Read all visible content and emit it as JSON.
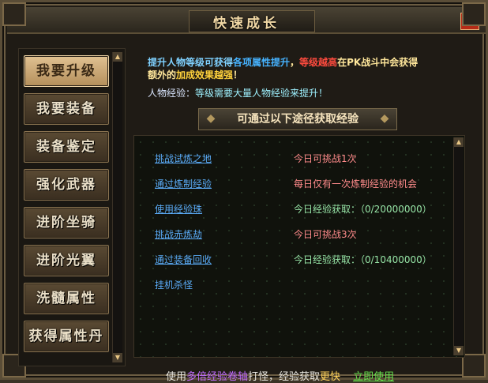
{
  "window": {
    "title": "快速成长",
    "close_label": "X"
  },
  "sidebar": {
    "items": [
      {
        "label": "我要升级",
        "active": true
      },
      {
        "label": "我要装备",
        "active": false
      },
      {
        "label": "装备鉴定",
        "active": false
      },
      {
        "label": "强化武器",
        "active": false
      },
      {
        "label": "进阶坐骑",
        "active": false
      },
      {
        "label": "进阶光翼",
        "active": false
      },
      {
        "label": "洗髓属性",
        "active": false
      },
      {
        "label": "获得属性丹",
        "active": false
      }
    ],
    "scroll_up": "▲",
    "scroll_down": "▼"
  },
  "intro": {
    "p1": "提升人物等级可获得",
    "p2": "各项属性提升",
    "p3": "，",
    "p4": "等级越高",
    "p5": "在PK战斗中会获得",
    "p6": "额外的",
    "p7": "加成效果越强",
    "p8": "！"
  },
  "exp_label": "人物经验：",
  "exp_value": "等级需要大量人物经验来提升！",
  "banner": "可通过以下途径获取经验",
  "rows": [
    {
      "link": "挑战试炼之地",
      "info": "今日可挑战1次",
      "link_type": "link",
      "info_color": "red"
    },
    {
      "link": "通过炼制经验",
      "info": "每日仅有一次炼制经验的机会",
      "link_type": "link",
      "info_color": "red"
    },
    {
      "link": "使用经验珠",
      "info": "今日经验获取：（0/20000000）",
      "link_type": "link",
      "info_color": "green"
    },
    {
      "link": "挑战赤炼劫",
      "info": "今日可挑战3次",
      "link_type": "link",
      "info_color": "red"
    },
    {
      "link": "通过装备回收",
      "info": "今日经验获取：（0/10400000）",
      "link_type": "link",
      "info_color": "green"
    },
    {
      "link": "挂机杀怪",
      "info": "",
      "link_type": "plain",
      "info_color": "green"
    }
  ],
  "bottom": {
    "t1": "使用",
    "t2": "多倍经验卷轴",
    "t3": "打怪，经验获取",
    "t4": "更快",
    "use_now": "立即使用"
  },
  "colors": {
    "accent": "#e9c785",
    "link": "#5aaaf5",
    "warn": "#ff8b8b",
    "ok": "#97e5a7"
  }
}
